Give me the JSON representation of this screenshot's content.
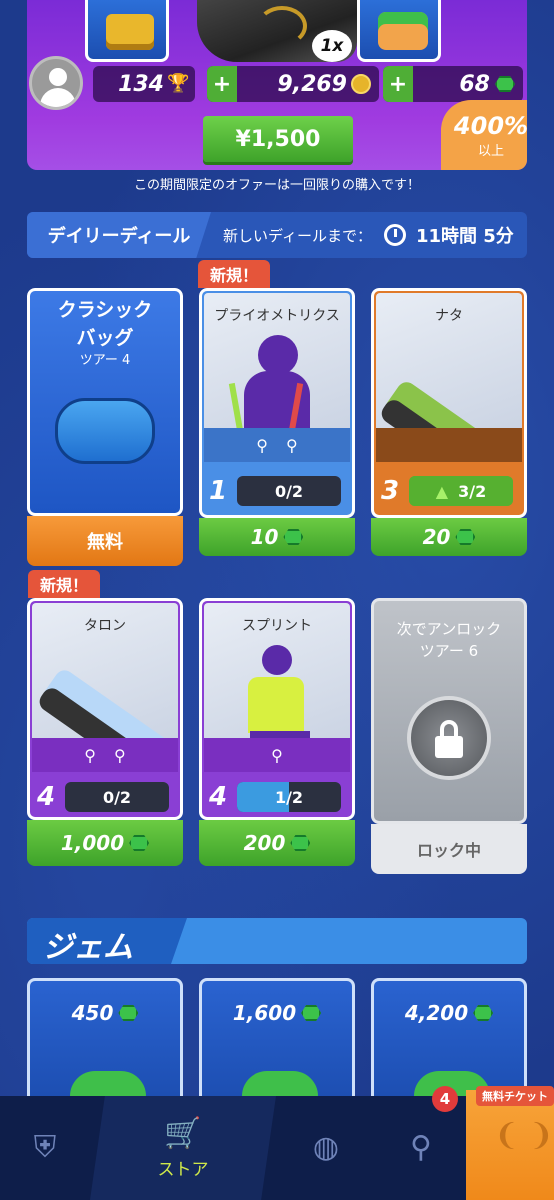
{
  "offer": {
    "multiplier": "1x",
    "trophies": "134",
    "coins": "9,269",
    "gems": "68",
    "price": "¥1,500",
    "bonus_pct": "400%",
    "bonus_sub": "以上",
    "note": "この期間限定のオファーは一回限りの購入です！"
  },
  "daily": {
    "title": "デイリーディール",
    "next_label": "新しいディールまで：",
    "time": "11時間 5分"
  },
  "cards": [
    {
      "name": "クラシック",
      "name2": "バッグ",
      "tier": "ツアー 4",
      "price": "無料"
    },
    {
      "name": "プライオメトリクス",
      "level": "1",
      "progress": "0/2",
      "progress_fraction": 0,
      "price": "10",
      "new_tag": "新規！"
    },
    {
      "name": "ナタ",
      "level": "3",
      "progress": "3/2",
      "progress_fraction": 1,
      "price": "20"
    },
    {
      "name": "タロン",
      "level": "4",
      "progress": "0/2",
      "progress_fraction": 0,
      "price": "1,000",
      "new_tag": "新規！"
    },
    {
      "name": "スプリント",
      "level": "4",
      "progress": "1/2",
      "progress_fraction": 0.5,
      "price": "200"
    },
    {
      "unlock_label": "次でアンロック",
      "unlock_tier": "ツアー 6",
      "price": "ロック中"
    }
  ],
  "gems_section": {
    "title": "ジェム",
    "packs": [
      "450",
      "1,600",
      "4,200"
    ]
  },
  "nav": {
    "store_label": "ストア",
    "racket_badge": "4",
    "ticket_label": "無料チケット"
  },
  "colors": {
    "accent_green": "#4fae36",
    "bag_orange": "#f0891a",
    "purple": "#8a3fd4"
  }
}
